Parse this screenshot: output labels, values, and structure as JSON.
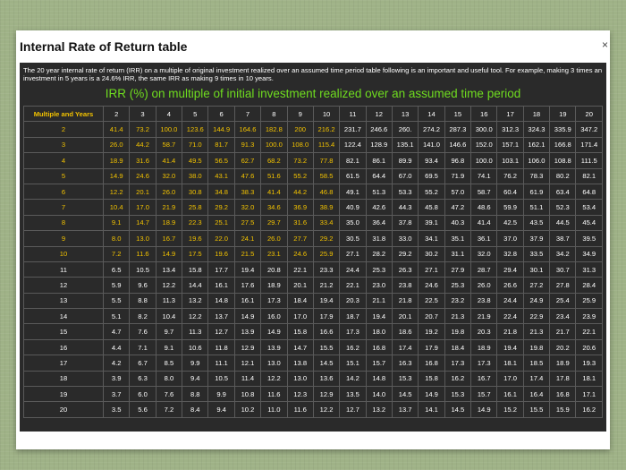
{
  "window": {
    "title": "Internal Rate of Return table",
    "close_label": "×"
  },
  "intro_text": "The 20 year internal rate of return (IRR) on a multiple of original investment realized over an assumed time period table following is an important and useful tool. For example, making 3 times an investment in 5 years is a 24.6% IRR, the same IRR as making 9 times in 10 years.",
  "table_title": "IRR (%) on multiple of initial investment realized over an assumed time period",
  "table": {
    "corner_label": "Multiple and Years",
    "years": [
      "2",
      "3",
      "4",
      "5",
      "6",
      "7",
      "8",
      "9",
      "10",
      "11",
      "12",
      "13",
      "14",
      "15",
      "16",
      "17",
      "18",
      "19",
      "20"
    ],
    "rows": [
      {
        "m": "2",
        "v": [
          "41.4",
          "73.2",
          "100.0",
          "123.6",
          "144.9",
          "164.6",
          "182.8",
          "200",
          "216.2",
          "231.7",
          "246.6",
          "260.",
          "274.2",
          "287.3",
          "300.0",
          "312.3",
          "324.3",
          "335.9",
          "347.2"
        ]
      },
      {
        "m": "3",
        "v": [
          "26.0",
          "44.2",
          "58.7",
          "71.0",
          "81.7",
          "91.3",
          "100.0",
          "108.0",
          "115.4",
          "122.4",
          "128.9",
          "135.1",
          "141.0",
          "146.6",
          "152.0",
          "157.1",
          "162.1",
          "166.8",
          "171.4"
        ]
      },
      {
        "m": "4",
        "v": [
          "18.9",
          "31.6",
          "41.4",
          "49.5",
          "56.5",
          "62.7",
          "68.2",
          "73.2",
          "77.8",
          "82.1",
          "86.1",
          "89.9",
          "93.4",
          "96.8",
          "100.0",
          "103.1",
          "106.0",
          "108.8",
          "111.5"
        ]
      },
      {
        "m": "5",
        "v": [
          "14.9",
          "24.6",
          "32.0",
          "38.0",
          "43.1",
          "47.6",
          "51.6",
          "55.2",
          "58.5",
          "61.5",
          "64.4",
          "67.0",
          "69.5",
          "71.9",
          "74.1",
          "76.2",
          "78.3",
          "80.2",
          "82.1"
        ]
      },
      {
        "m": "6",
        "v": [
          "12.2",
          "20.1",
          "26.0",
          "30.8",
          "34.8",
          "38.3",
          "41.4",
          "44.2",
          "46.8",
          "49.1",
          "51.3",
          "53.3",
          "55.2",
          "57.0",
          "58.7",
          "60.4",
          "61.9",
          "63.4",
          "64.8"
        ]
      },
      {
        "m": "7",
        "v": [
          "10.4",
          "17.0",
          "21.9",
          "25.8",
          "29.2",
          "32.0",
          "34.6",
          "36.9",
          "38.9",
          "40.9",
          "42.6",
          "44.3",
          "45.8",
          "47.2",
          "48.6",
          "59.9",
          "51.1",
          "52.3",
          "53.4"
        ]
      },
      {
        "m": "8",
        "v": [
          "9.1",
          "14.7",
          "18.9",
          "22.3",
          "25.1",
          "27.5",
          "29.7",
          "31.6",
          "33.4",
          "35.0",
          "36.4",
          "37.8",
          "39.1",
          "40.3",
          "41.4",
          "42.5",
          "43.5",
          "44.5",
          "45.4"
        ]
      },
      {
        "m": "9",
        "v": [
          "8.0",
          "13.0",
          "16.7",
          "19.6",
          "22.0",
          "24.1",
          "26.0",
          "27.7",
          "29.2",
          "30.5",
          "31.8",
          "33.0",
          "34.1",
          "35.1",
          "36.1",
          "37.0",
          "37.9",
          "38.7",
          "39.5"
        ]
      },
      {
        "m": "10",
        "v": [
          "7.2",
          "11.6",
          "14.9",
          "17.5",
          "19.6",
          "21.5",
          "23.1",
          "24.6",
          "25.9",
          "27.1",
          "28.2",
          "29.2",
          "30.2",
          "31.1",
          "32.0",
          "32.8",
          "33.5",
          "34.2",
          "34.9"
        ]
      },
      {
        "m": "11",
        "v": [
          "6.5",
          "10.5",
          "13.4",
          "15.8",
          "17.7",
          "19.4",
          "20.8",
          "22.1",
          "23.3",
          "24.4",
          "25.3",
          "26.3",
          "27.1",
          "27.9",
          "28.7",
          "29.4",
          "30.1",
          "30.7",
          "31.3"
        ]
      },
      {
        "m": "12",
        "v": [
          "5.9",
          "9.6",
          "12.2",
          "14.4",
          "16.1",
          "17.6",
          "18.9",
          "20.1",
          "21.2",
          "22.1",
          "23.0",
          "23.8",
          "24.6",
          "25.3",
          "26.0",
          "26.6",
          "27.2",
          "27.8",
          "28.4"
        ]
      },
      {
        "m": "13",
        "v": [
          "5.5",
          "8.8",
          "11.3",
          "13.2",
          "14.8",
          "16.1",
          "17.3",
          "18.4",
          "19.4",
          "20.3",
          "21.1",
          "21.8",
          "22.5",
          "23.2",
          "23.8",
          "24.4",
          "24.9",
          "25.4",
          "25.9"
        ]
      },
      {
        "m": "14",
        "v": [
          "5.1",
          "8.2",
          "10.4",
          "12.2",
          "13.7",
          "14.9",
          "16.0",
          "17.0",
          "17.9",
          "18.7",
          "19.4",
          "20.1",
          "20.7",
          "21.3",
          "21.9",
          "22.4",
          "22.9",
          "23.4",
          "23.9"
        ]
      },
      {
        "m": "15",
        "v": [
          "4.7",
          "7.6",
          "9.7",
          "11.3",
          "12.7",
          "13.9",
          "14.9",
          "15.8",
          "16.6",
          "17.3",
          "18.0",
          "18.6",
          "19.2",
          "19.8",
          "20.3",
          "21.8",
          "21.3",
          "21.7",
          "22.1"
        ]
      },
      {
        "m": "16",
        "v": [
          "4.4",
          "7.1",
          "9.1",
          "10.6",
          "11.8",
          "12.9",
          "13.9",
          "14.7",
          "15.5",
          "16.2",
          "16.8",
          "17.4",
          "17.9",
          "18.4",
          "18.9",
          "19.4",
          "19.8",
          "20.2",
          "20.6"
        ]
      },
      {
        "m": "17",
        "v": [
          "4.2",
          "6.7",
          "8.5",
          "9.9",
          "11.1",
          "12.1",
          "13.0",
          "13.8",
          "14.5",
          "15.1",
          "15.7",
          "16.3",
          "16.8",
          "17.3",
          "17.3",
          "18.1",
          "18.5",
          "18.9",
          "19.3"
        ]
      },
      {
        "m": "18",
        "v": [
          "3.9",
          "6.3",
          "8.0",
          "9.4",
          "10.5",
          "11.4",
          "12.2",
          "13.0",
          "13.6",
          "14.2",
          "14.8",
          "15.3",
          "15.8",
          "16.2",
          "16.7",
          "17.0",
          "17.4",
          "17.8",
          "18.1"
        ]
      },
      {
        "m": "19",
        "v": [
          "3.7",
          "6.0",
          "7.6",
          "8.8",
          "9.9",
          "10.8",
          "11.6",
          "12.3",
          "12.9",
          "13.5",
          "14.0",
          "14.5",
          "14.9",
          "15.3",
          "15.7",
          "16.1",
          "16.4",
          "16.8",
          "17.1"
        ]
      },
      {
        "m": "20",
        "v": [
          "3.5",
          "5.6",
          "7.2",
          "8.4",
          "9.4",
          "10.2",
          "11.0",
          "11.6",
          "12.2",
          "12.7",
          "13.2",
          "13.7",
          "14.1",
          "14.5",
          "14.9",
          "15.2",
          "15.5",
          "15.9",
          "16.2"
        ]
      }
    ]
  },
  "colors": {
    "highlight": "#f2c200",
    "heading": "#6fdc1f",
    "panel": "#2a2a2a"
  }
}
